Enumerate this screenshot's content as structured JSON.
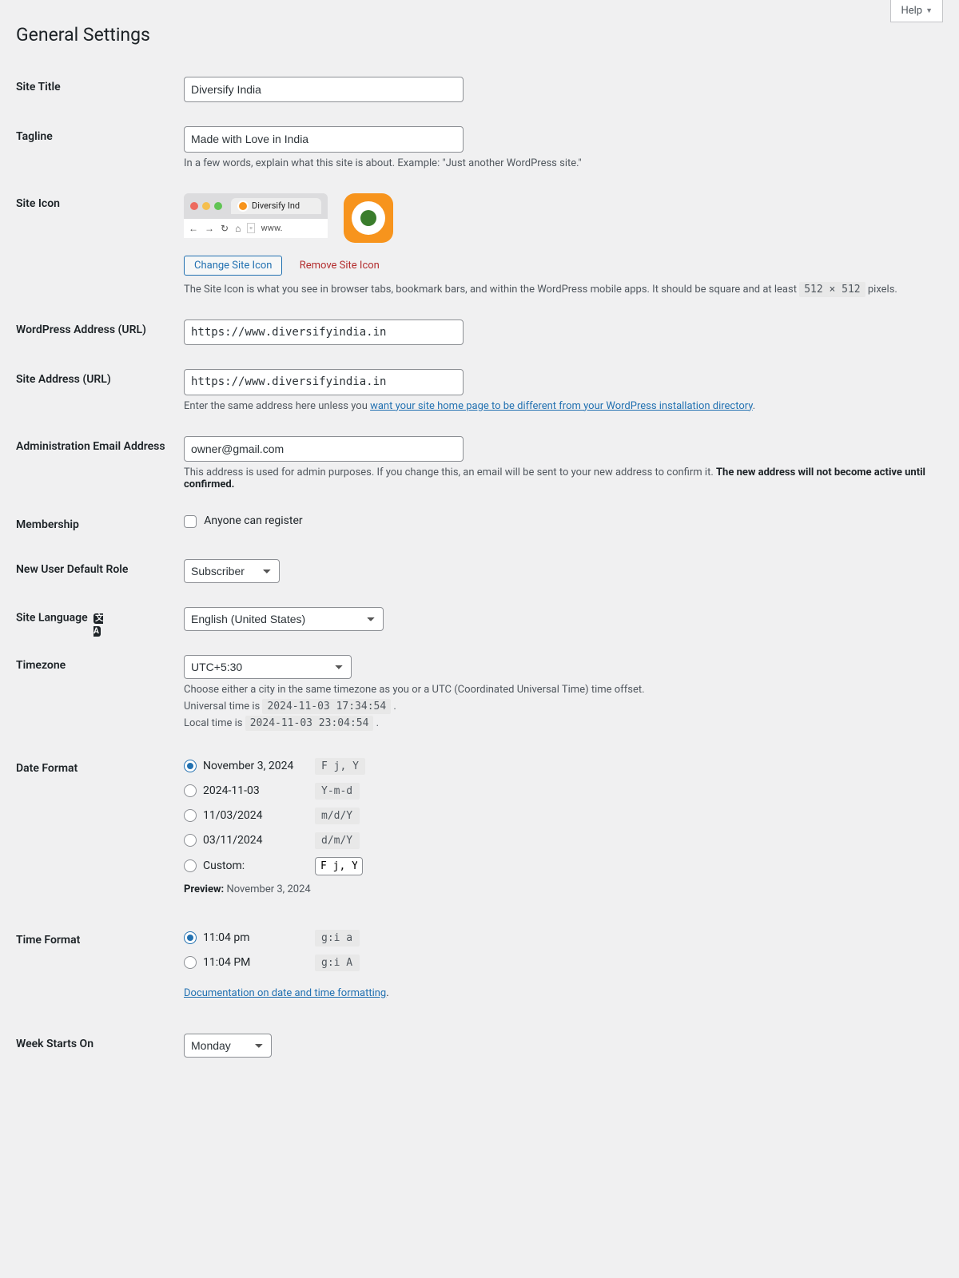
{
  "help": "Help",
  "page_title": "General Settings",
  "site_title": {
    "label": "Site Title",
    "value": "Diversify India"
  },
  "tagline": {
    "label": "Tagline",
    "value": "Made with Love in India",
    "help": "In a few words, explain what this site is about. Example: \"Just another WordPress site.\""
  },
  "site_icon": {
    "label": "Site Icon",
    "tab_text": "Diversify Ind",
    "url_text": "www.",
    "change_btn": "Change Site Icon",
    "remove_link": "Remove Site Icon",
    "help_pre": "The Site Icon is what you see in browser tabs, bookmark bars, and within the WordPress mobile apps. It should be square and at least ",
    "help_code": "512 × 512",
    "help_post": " pixels."
  },
  "wp_url": {
    "label": "WordPress Address (URL)",
    "value": "https://www.diversifyindia.in"
  },
  "site_url": {
    "label": "Site Address (URL)",
    "value": "https://www.diversifyindia.in",
    "help_pre": "Enter the same address here unless you ",
    "help_link": "want your site home page to be different from your WordPress installation directory",
    "help_post": "."
  },
  "admin_email": {
    "label": "Administration Email Address",
    "value": "owner@gmail.com",
    "help_plain": "This address is used for admin purposes. If you change this, an email will be sent to your new address to confirm it. ",
    "help_strong": "The new address will not become active until confirmed."
  },
  "membership": {
    "label": "Membership",
    "checkbox": "Anyone can register"
  },
  "default_role": {
    "label": "New User Default Role",
    "value": "Subscriber"
  },
  "site_language": {
    "label": "Site Language",
    "value": "English (United States)"
  },
  "timezone": {
    "label": "Timezone",
    "value": "UTC+5:30",
    "help": "Choose either a city in the same timezone as you or a UTC (Coordinated Universal Time) time offset.",
    "utc_pre": "Universal time is ",
    "utc_val": "2024-11-03 17:34:54",
    "local_pre": "Local time is ",
    "local_val": "2024-11-03 23:04:54"
  },
  "date_format": {
    "label": "Date Format",
    "options": [
      {
        "label": "November 3, 2024",
        "code": "F j, Y",
        "checked": true
      },
      {
        "label": "2024-11-03",
        "code": "Y-m-d"
      },
      {
        "label": "11/03/2024",
        "code": "m/d/Y"
      },
      {
        "label": "03/11/2024",
        "code": "d/m/Y"
      }
    ],
    "custom_label": "Custom:",
    "custom_value": "F j, Y",
    "preview_label": "Preview:",
    "preview_value": "November 3, 2024"
  },
  "time_format": {
    "label": "Time Format",
    "options": [
      {
        "label": "11:04 pm",
        "code": "g:i a",
        "checked": true
      },
      {
        "label": "11:04 PM",
        "code": "g:i A"
      }
    ],
    "doc_link": "Documentation on date and time formatting"
  },
  "week_start": {
    "label": "Week Starts On",
    "value": "Monday"
  }
}
